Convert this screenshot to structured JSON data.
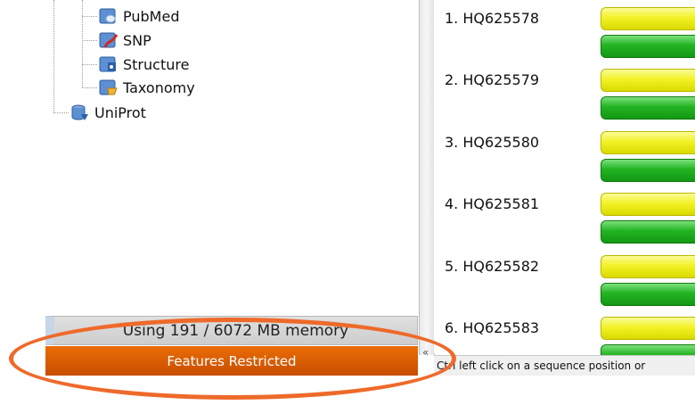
{
  "tree": {
    "items": [
      {
        "label": "PubMed",
        "icon": "pubmed-db-icon"
      },
      {
        "label": "SNP",
        "icon": "snp-db-icon"
      },
      {
        "label": "Structure",
        "icon": "structure-db-icon"
      },
      {
        "label": "Taxonomy",
        "icon": "taxonomy-db-icon"
      },
      {
        "label": "UniProt",
        "icon": "uniprot-db-icon"
      }
    ]
  },
  "sequences": [
    {
      "label": "1. HQ625578"
    },
    {
      "label": "2. HQ625579"
    },
    {
      "label": "3. HQ625580"
    },
    {
      "label": "4. HQ625581"
    },
    {
      "label": "5. HQ625582"
    },
    {
      "label": "6. HQ625583"
    }
  ],
  "memory": {
    "text": "Using 191 / 6072 MB memory"
  },
  "features": {
    "text": "Features Restricted"
  },
  "collapse": {
    "glyph": "«"
  },
  "status": {
    "text": "Ctrl left click on a sequence position or"
  },
  "colors": {
    "accent": "#e8600a",
    "highlight": "#ee6a2a",
    "bar_yellow": "#f2f227",
    "bar_green": "#22b322"
  }
}
